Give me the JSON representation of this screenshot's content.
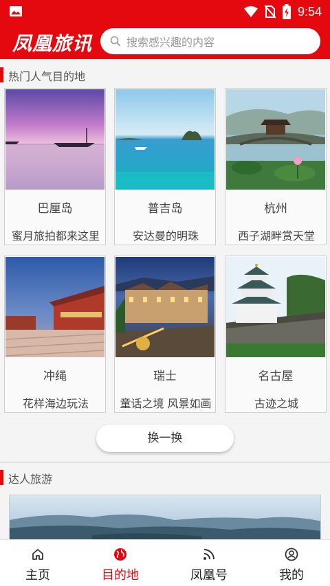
{
  "status_bar": {
    "time": "9:54"
  },
  "header": {
    "logo": "凤凰旅讯",
    "search_placeholder": "搜索感兴趣的内容"
  },
  "hot_section": {
    "title": "热门人气目的地",
    "destinations": [
      {
        "name": "巴厘岛",
        "desc": "蜜月旅拍都来这里"
      },
      {
        "name": "普吉岛",
        "desc": "安达曼的明珠"
      },
      {
        "name": "杭州",
        "desc": "西子湖畔赏天堂"
      },
      {
        "name": "冲绳",
        "desc": "花样海边玩法"
      },
      {
        "name": "瑞士",
        "desc": "童话之境 风景如画"
      },
      {
        "name": "名古屋",
        "desc": "古迹之城"
      }
    ],
    "refresh_label": "换一换"
  },
  "expert_section": {
    "title": "达人旅游"
  },
  "tabbar": {
    "items": [
      {
        "label": "主页",
        "icon": "home-icon",
        "active": false
      },
      {
        "label": "目的地",
        "icon": "globe-icon",
        "active": true
      },
      {
        "label": "凤凰号",
        "icon": "rss-icon",
        "active": false
      },
      {
        "label": "我的",
        "icon": "user-icon",
        "active": false
      }
    ]
  },
  "colors": {
    "brand": "#e4080f",
    "active_tab": "#e4080f"
  }
}
